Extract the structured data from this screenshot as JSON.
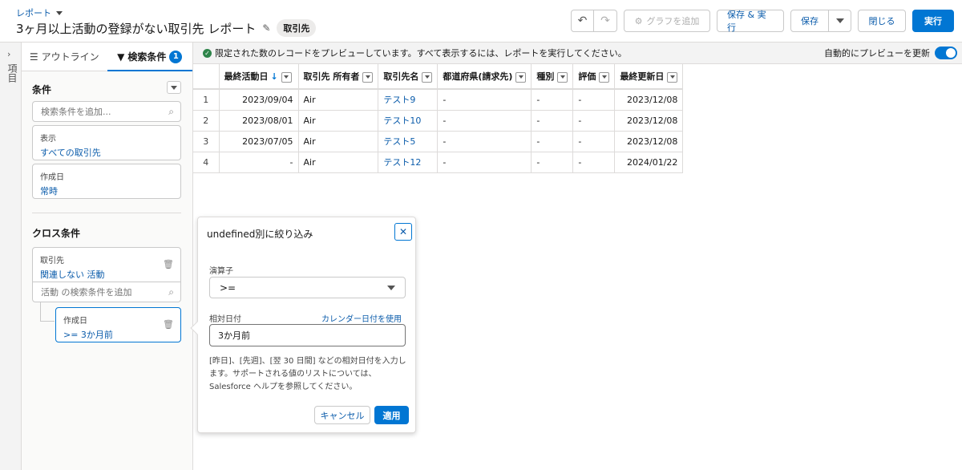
{
  "header": {
    "breadcrumb": "レポート",
    "title": "3ヶ月以上活動の登録がない取引先 レポート",
    "object_badge": "取引先",
    "undo_label": "↶",
    "redo_label": "↷",
    "add_chart_label": "グラフを追加",
    "save_run_label": "保存 & 実行",
    "save_label": "保存",
    "close_label": "閉じる",
    "run_label": "実行"
  },
  "rail": {
    "label": "項目"
  },
  "panel": {
    "tabs": [
      {
        "label": "アウトライン"
      },
      {
        "label": "検索条件",
        "count": "1"
      }
    ],
    "filters_title": "条件",
    "search_placeholder": "検索条件を追加...",
    "filters": [
      {
        "key": "表示",
        "value": "すべての取引先"
      },
      {
        "key": "作成日",
        "value": "常時"
      }
    ],
    "cross_title": "クロス条件",
    "cross": {
      "key": "取引先",
      "value": "関連しない 活動",
      "search_placeholder": "活動 の検索条件を追加",
      "subfilter": {
        "key": "作成日",
        "value": ">= 3か月前"
      }
    }
  },
  "notice": {
    "text": "限定された数のレコードをプレビューしています。すべて表示するには、レポートを実行してください。",
    "auto_preview_label": "自動的にプレビューを更新"
  },
  "table": {
    "columns": [
      "最終活動日",
      "取引先 所有者",
      "取引先名",
      "都道府県(請求先)",
      "種別",
      "評価",
      "最終更新日"
    ],
    "rows": [
      [
        "1",
        "2023/09/04",
        "Air",
        "テスト9",
        "-",
        "-",
        "-",
        "2023/12/08"
      ],
      [
        "2",
        "2023/08/01",
        "Air",
        "テスト10",
        "-",
        "-",
        "-",
        "2023/12/08"
      ],
      [
        "3",
        "2023/07/05",
        "Air",
        "テスト5",
        "-",
        "-",
        "-",
        "2023/12/08"
      ],
      [
        "4",
        "-",
        "Air",
        "テスト12",
        "-",
        "-",
        "-",
        "2024/01/22"
      ]
    ]
  },
  "popover": {
    "title": "undefined別に絞り込み",
    "operator_label": "演算子",
    "operator_value": ">=",
    "relative_date_label": "相対日付",
    "calendar_link": "カレンダー日付を使用",
    "date_value": "3か月前",
    "help_text": "[昨日]、[先週]、[翌 30 日間] などの相対日付を入力します。サポートされる値のリストについては、Salesforce ヘルプを参照してください。",
    "cancel_label": "キャンセル",
    "apply_label": "適用"
  },
  "colors": {
    "brand": "#0176d3",
    "link": "#0b5cab",
    "success": "#2e844a"
  }
}
